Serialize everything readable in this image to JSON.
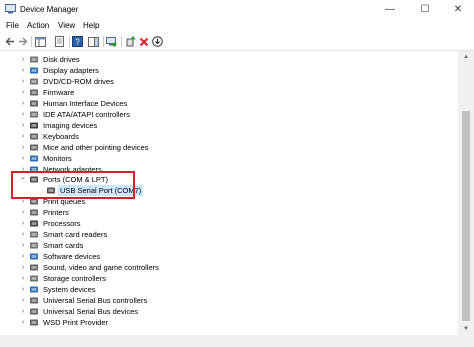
{
  "window": {
    "title": "Device Manager",
    "minimize": "—",
    "maximize": "☐",
    "close": "✕"
  },
  "menu": [
    "File",
    "Action",
    "View",
    "Help"
  ],
  "toolbar": {
    "back_icon": "back-arrow-icon",
    "forward_icon": "forward-arrow-icon"
  },
  "tree": {
    "items": [
      {
        "label": "Disk drives",
        "icon": "disk-drive-icon",
        "color": "#707070",
        "expanded": false
      },
      {
        "label": "Display adapters",
        "icon": "display-adapter-icon",
        "color": "#2a6ebb",
        "expanded": false
      },
      {
        "label": "DVD/CD-ROM drives",
        "icon": "dvd-icon",
        "color": "#707070",
        "expanded": false
      },
      {
        "label": "Firmware",
        "icon": "firmware-icon",
        "color": "#606060",
        "expanded": false
      },
      {
        "label": "Human Interface Devices",
        "icon": "hid-icon",
        "color": "#5a5a5a",
        "expanded": false
      },
      {
        "label": "IDE ATA/ATAPI controllers",
        "icon": "ide-controller-icon",
        "color": "#707070",
        "expanded": false
      },
      {
        "label": "Imaging devices",
        "icon": "camera-icon",
        "color": "#404040",
        "expanded": false
      },
      {
        "label": "Keyboards",
        "icon": "keyboard-icon",
        "color": "#606060",
        "expanded": false
      },
      {
        "label": "Mice and other pointing devices",
        "icon": "mouse-icon",
        "color": "#606060",
        "expanded": false
      },
      {
        "label": "Monitors",
        "icon": "monitor-icon",
        "color": "#2a6ebb",
        "expanded": false
      },
      {
        "label": "Network adapters",
        "icon": "network-adapter-icon",
        "color": "#2a6ebb",
        "expanded": false
      },
      {
        "label": "Ports (COM & LPT)",
        "icon": "port-icon",
        "color": "#505050",
        "expanded": true
      },
      {
        "label": "USB Serial Port (COM7)",
        "icon": "serial-port-icon",
        "color": "#505050",
        "child": true,
        "selected": true
      },
      {
        "label": "Print queues",
        "icon": "print-queue-icon",
        "color": "#606060",
        "expanded": false
      },
      {
        "label": "Printers",
        "icon": "printer-icon",
        "color": "#606060",
        "expanded": false
      },
      {
        "label": "Processors",
        "icon": "processor-icon",
        "color": "#404040",
        "expanded": false
      },
      {
        "label": "Smart card readers",
        "icon": "smart-card-reader-icon",
        "color": "#707070",
        "expanded": false
      },
      {
        "label": "Smart cards",
        "icon": "smart-card-icon",
        "color": "#707070",
        "expanded": false
      },
      {
        "label": "Software devices",
        "icon": "software-device-icon",
        "color": "#2a6ebb",
        "expanded": false
      },
      {
        "label": "Sound, video and game controllers",
        "icon": "sound-icon",
        "color": "#606060",
        "expanded": false
      },
      {
        "label": "Storage controllers",
        "icon": "storage-controller-icon",
        "color": "#707070",
        "expanded": false
      },
      {
        "label": "System devices",
        "icon": "system-device-icon",
        "color": "#2a6ebb",
        "expanded": false
      },
      {
        "label": "Universal Serial Bus controllers",
        "icon": "usb-controller-icon",
        "color": "#606060",
        "expanded": false
      },
      {
        "label": "Universal Serial Bus devices",
        "icon": "usb-device-icon",
        "color": "#606060",
        "expanded": false
      },
      {
        "label": "WSD Print Provider",
        "icon": "wsd-print-icon",
        "color": "#606060",
        "expanded": false
      }
    ]
  },
  "colors": {
    "highlight_border": "#d2232a",
    "selection": "#cce8ff"
  }
}
